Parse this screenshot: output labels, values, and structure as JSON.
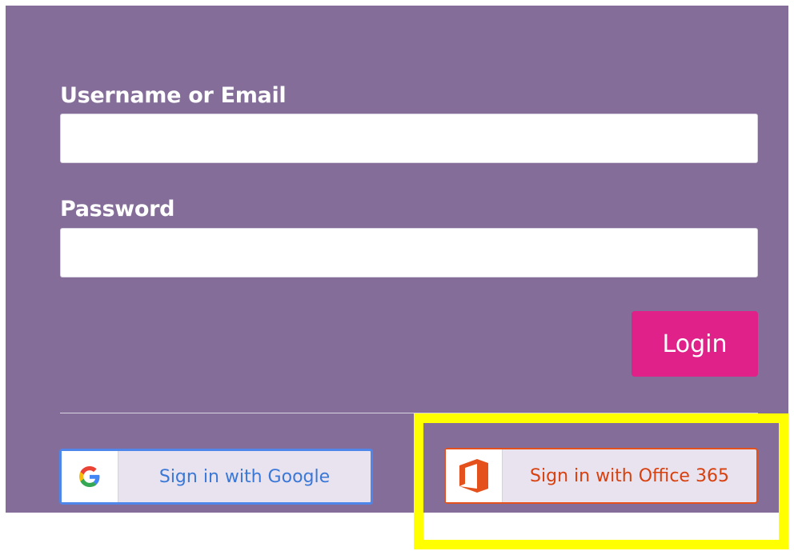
{
  "form": {
    "username_label": "Username or Email",
    "username_value": "",
    "password_label": "Password",
    "password_value": "",
    "login_label": "Login"
  },
  "sso": {
    "google_label": "Sign in with Google",
    "google_icon": "google-g-icon",
    "office_label": "Sign in with Office 365",
    "office_icon": "office-365-icon"
  },
  "colors": {
    "panel_background": "#846d99",
    "login_button": "#e0218a",
    "google_accent": "#4e86ea",
    "office_accent": "#e4511c",
    "highlight": "#ffff00"
  }
}
